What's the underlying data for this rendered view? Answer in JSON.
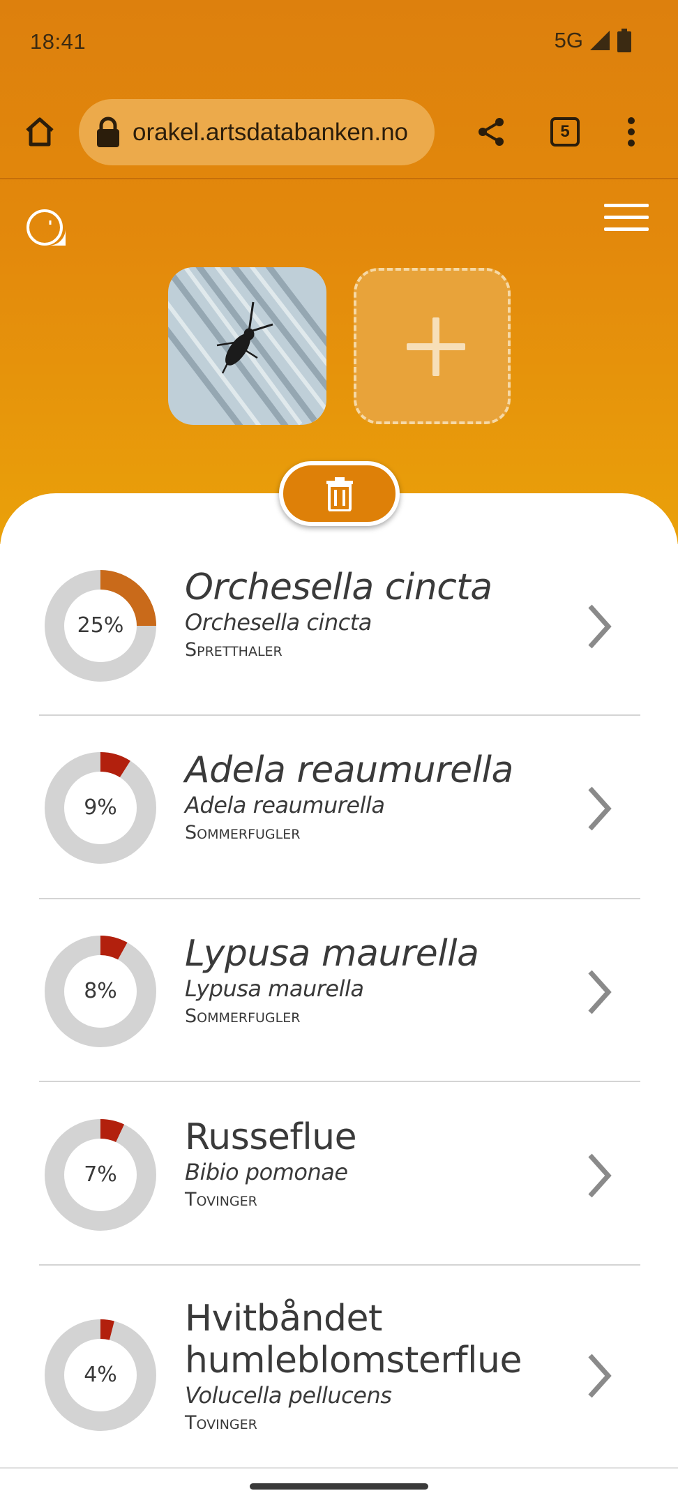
{
  "status_bar": {
    "time": "18:41",
    "network": "5G"
  },
  "browser": {
    "url": "orakel.artsdatabanken.no",
    "tab_count": "5"
  },
  "colors": {
    "accent": "#de8008",
    "ring_track": "#d3d3d3",
    "ring_high": "#c96a1a",
    "ring_low": "#b2200d"
  },
  "results": [
    {
      "percent": "25%",
      "confidence": 0.25,
      "title": "Orchesella cincta",
      "title_italic": true,
      "scientific": "Orchesella cincta",
      "group": "Spretthaler"
    },
    {
      "percent": "9%",
      "confidence": 0.09,
      "title": "Adela reaumurella",
      "title_italic": true,
      "scientific": "Adela reaumurella",
      "group": "Sommerfugler"
    },
    {
      "percent": "8%",
      "confidence": 0.08,
      "title": "Lypusa maurella",
      "title_italic": true,
      "scientific": "Lypusa maurella",
      "group": "Sommerfugler"
    },
    {
      "percent": "7%",
      "confidence": 0.07,
      "title": "Russeflue",
      "title_italic": false,
      "scientific": "Bibio pomonae",
      "group": "Tovinger"
    },
    {
      "percent": "4%",
      "confidence": 0.04,
      "title": "Hvitbåndet humleblomsterflue",
      "title_italic": false,
      "scientific": "Volucella pellucens",
      "group": "Tovinger"
    }
  ]
}
